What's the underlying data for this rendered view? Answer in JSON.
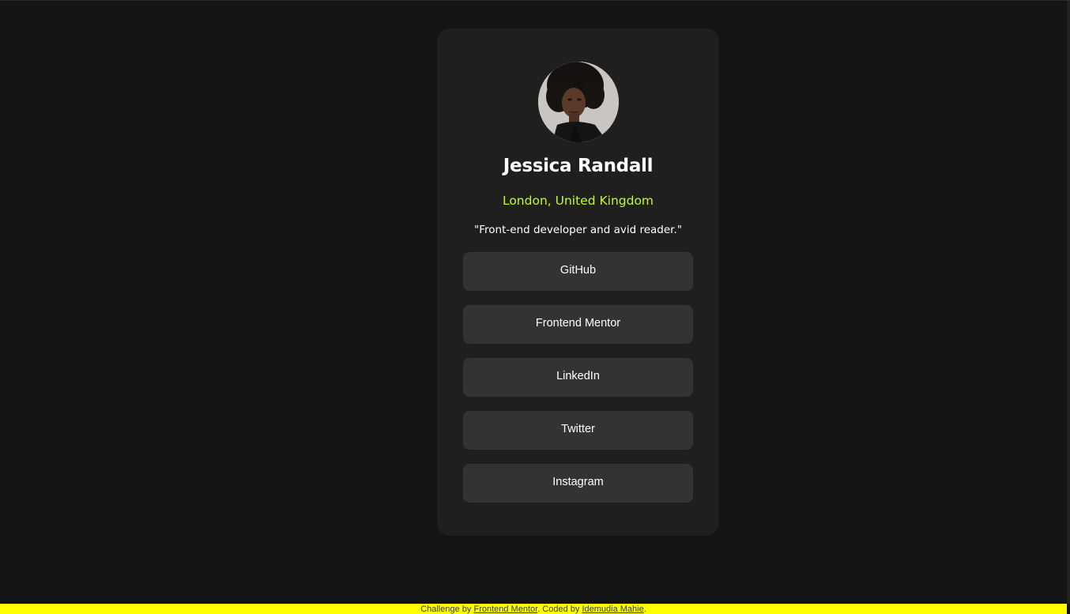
{
  "colors": {
    "page_background": "#141414",
    "card_background": "#1f1f1f",
    "button_background": "#333333",
    "accent_green": "#c4f82a",
    "footer_background": "#ffff00"
  },
  "profile": {
    "avatar_alt": "avatar",
    "name": "Jessica Randall",
    "location": "London, United Kingdom",
    "bio": "\"Front-end developer and avid reader.\""
  },
  "links": [
    {
      "label": "GitHub"
    },
    {
      "label": "Frontend Mentor"
    },
    {
      "label": "LinkedIn"
    },
    {
      "label": "Twitter"
    },
    {
      "label": "Instagram"
    }
  ],
  "footer": {
    "prefix": "Challenge by ",
    "challenge_link": "Frontend Mentor",
    "middle": ". Coded by ",
    "author_link": "Idemudia Mahie",
    "suffix": "."
  }
}
